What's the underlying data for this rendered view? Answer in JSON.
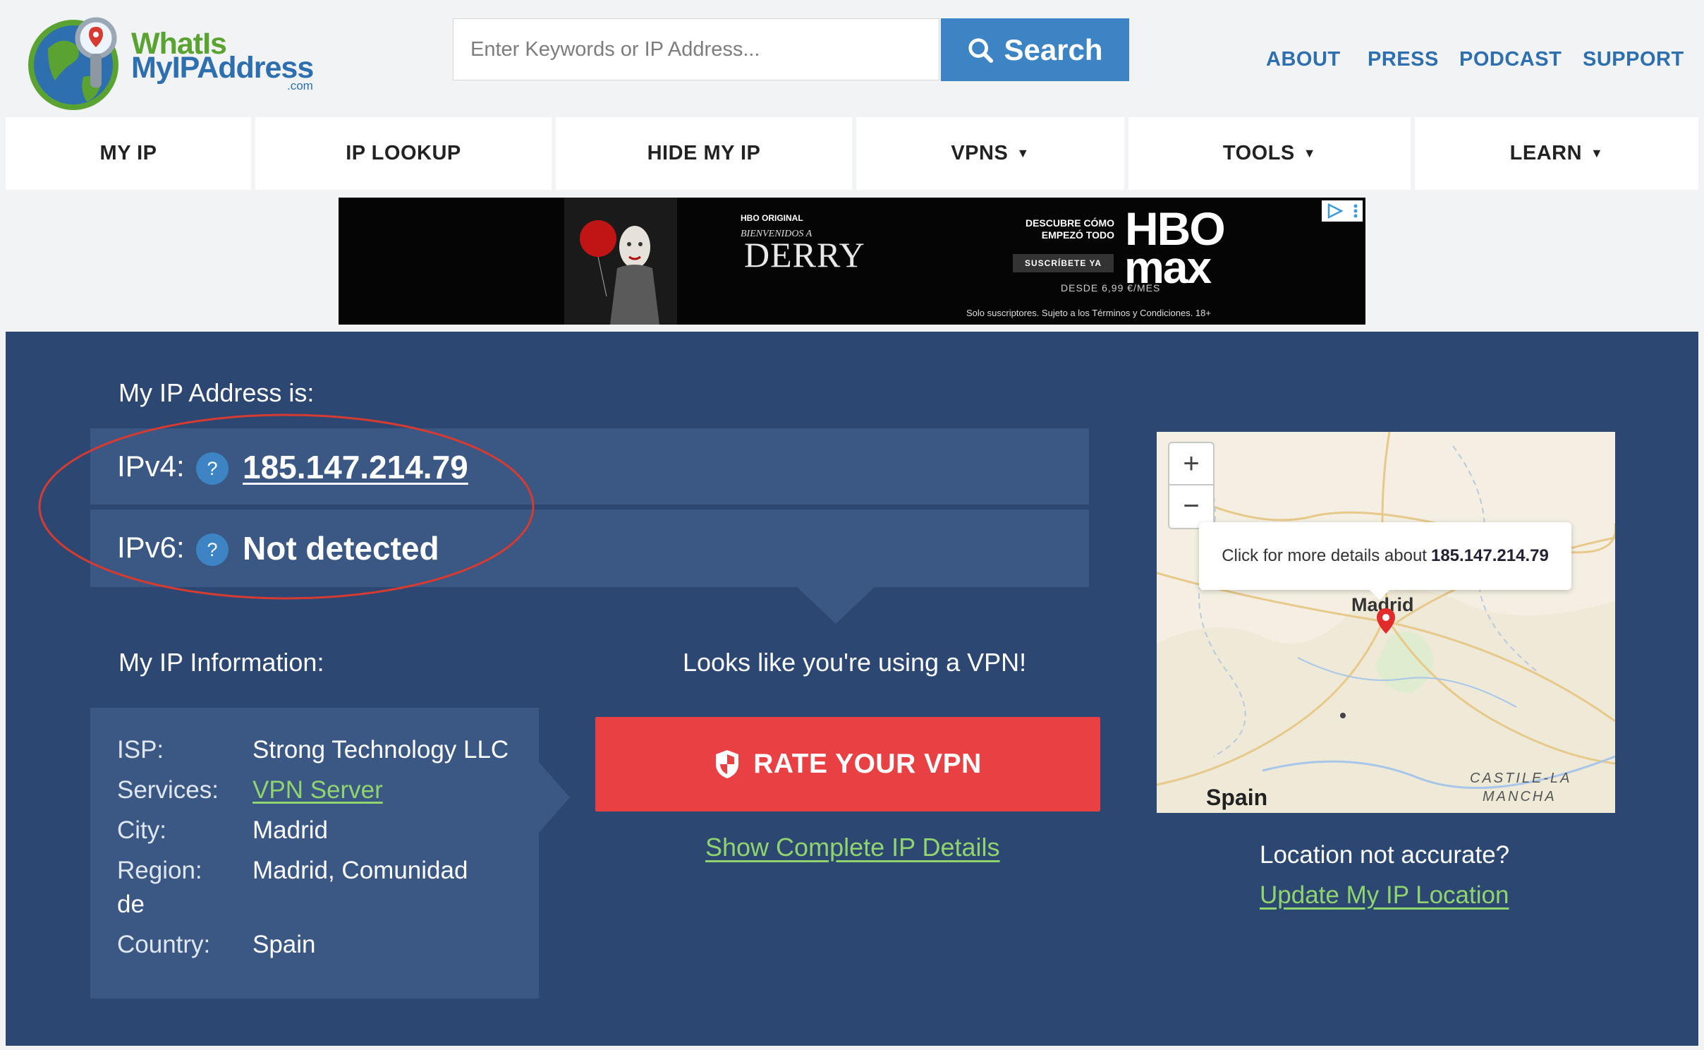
{
  "logo": {
    "line1": "WhatIs",
    "line2": "MyIPAddress",
    "line3": ".com"
  },
  "search": {
    "placeholder": "Enter Keywords or IP Address...",
    "button_label": "Search"
  },
  "top_links": [
    "ABOUT",
    "PRESS",
    "PODCAST",
    "SUPPORT"
  ],
  "main_nav": [
    {
      "label": "MY IP"
    },
    {
      "label": "IP LOOKUP"
    },
    {
      "label": "HIDE MY IP"
    },
    {
      "label": "VPNS",
      "caret": "▼"
    },
    {
      "label": "TOOLS",
      "caret": "▼"
    },
    {
      "label": "LEARN",
      "caret": "▼"
    }
  ],
  "ad": {
    "hbo_original": "HBO ORIGINAL",
    "bienvenidos": "BIENVENIDOS A",
    "derry": "DERRY",
    "tagline_1": "DESCUBRE CÓMO",
    "tagline_2": "EMPEZÓ TODO",
    "cta": "SUSCRÍBETE YA",
    "brand_1": "HBO",
    "brand_2": "max",
    "price": "DESDE 6,99 €/MES",
    "legal": "Solo suscriptores. Sujeto a los Términos y Condiciones. 18+"
  },
  "ip": {
    "heading": "My IP Address is:",
    "ipv4_label": "IPv4:",
    "ipv4_value": "185.147.214.79",
    "ipv6_label": "IPv6:",
    "ipv6_value": "Not detected",
    "help_glyph": "?"
  },
  "info": {
    "heading": "My IP Information:",
    "isp_label": "ISP:",
    "isp_value": "Strong Technology LLC",
    "services_label": "Services:",
    "services_value": "VPN Server",
    "city_label": "City:",
    "city_value": "Madrid",
    "region_label": "Region:",
    "region_value": "Madrid, Comunidad",
    "region_wrap": "de",
    "country_label": "Country:",
    "country_value": "Spain"
  },
  "vpn": {
    "notice": "Looks like you're using a VPN!",
    "rate_button": "RATE YOUR VPN",
    "details_link": "Show Complete IP Details"
  },
  "map": {
    "zoom_in": "+",
    "zoom_out": "−",
    "popup_prefix": "Click for more details about ",
    "popup_ip": "185.147.214.79",
    "city_label": "Madrid",
    "country_label": "Spain",
    "region_label_1": "CASTILE-LA",
    "region_label_2": "MANCHA"
  },
  "location": {
    "question": "Location not accurate?",
    "update_link": "Update My IP Location"
  },
  "colors": {
    "brand_blue": "#3c84c4",
    "panel": "#2c4771",
    "panel_box": "#3a5883",
    "vpn_red": "#e94143",
    "link_green": "#8fd46f",
    "annotation_red": "#d63b32"
  }
}
